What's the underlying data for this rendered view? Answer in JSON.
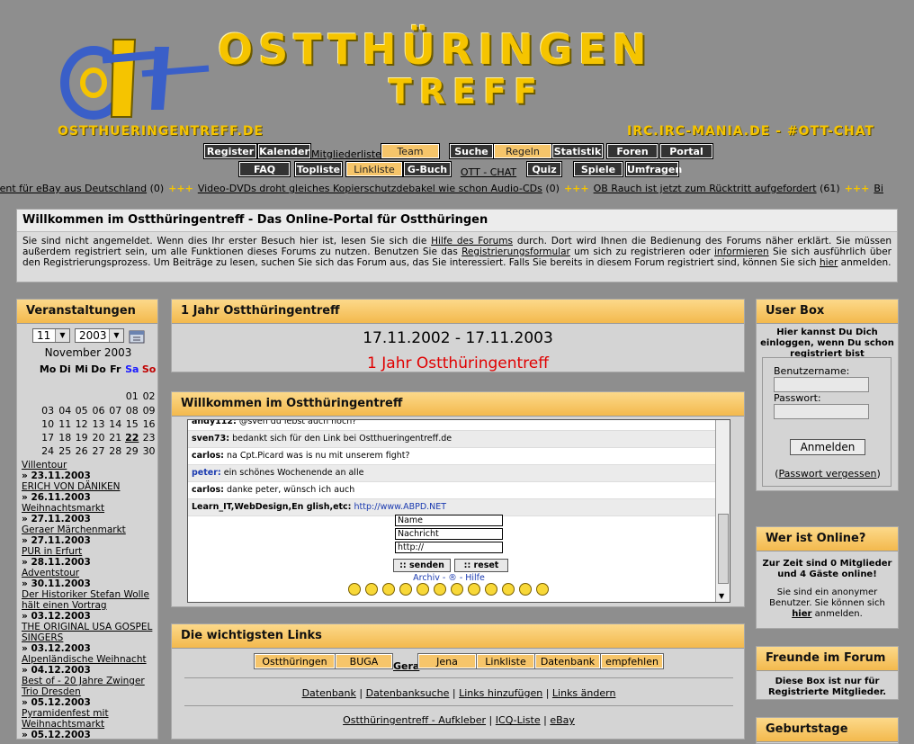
{
  "banner": {
    "title_line1": "OSTTHÜRINGEN",
    "title_line2": "TREFF",
    "url_left": "OSTTHUERINGENTREFF.DE",
    "url_right": "IRC.IRC-MANIA.DE - #OTT-CHAT",
    "logo_icon": "ott-logo-icon"
  },
  "nav_row1": [
    {
      "label": "Register",
      "style": "dark"
    },
    {
      "label": "Kalender",
      "style": "dark"
    },
    {
      "label": "Mitgliederliste",
      "style": "plain"
    },
    {
      "label": "Team",
      "style": "gold"
    },
    {
      "label": "Suche",
      "style": "dark"
    },
    {
      "label": "Regeln",
      "style": "gold"
    },
    {
      "label": "Statistik",
      "style": "dark"
    },
    {
      "label": "Foren",
      "style": "dark"
    },
    {
      "label": "Portal",
      "style": "dark"
    }
  ],
  "nav_row2": [
    {
      "label": "FAQ",
      "style": "dark"
    },
    {
      "label": "Topliste",
      "style": "dark"
    },
    {
      "label": "Linkliste",
      "style": "gold"
    },
    {
      "label": "G-Buch",
      "style": "dark"
    },
    {
      "label": "OTT - CHAT",
      "style": "plain"
    },
    {
      "label": "Quiz",
      "style": "dark"
    },
    {
      "label": "Spiele",
      "style": "dark"
    },
    {
      "label": "Umfragen",
      "style": "dark"
    }
  ],
  "ticker": [
    {
      "text": "current für eBay aus Deutschland",
      "count": "(0)"
    },
    {
      "text": "Video-DVDs droht gleiches Kopierschutzdebakel wie schon Audio-CDs",
      "count": "(0)"
    },
    {
      "text": "OB Rauch ist jetzt zum Rücktritt aufgefordert",
      "count": "(61)"
    },
    {
      "text": "Bi",
      "count": ""
    }
  ],
  "ticker_sep": "+++",
  "welcome": {
    "title": "Willkommen im Ostthüringentreff - Das Online-Portal für Ostthüringen",
    "t1": "Sie sind nicht angemeldet. Wenn dies Ihr erster Besuch hier ist, lesen Sie sich die ",
    "l1": "Hilfe des Forums",
    "t2": " durch. Dort wird Ihnen die Bedienung des Forums näher erklärt. Sie müssen außerdem registriert sein, um alle Funktionen dieses Forums zu nutzen. Benutzen Sie das ",
    "l2": "Registrierungsformular",
    "t3": " um sich zu registrieren oder ",
    "l3": "informieren",
    "t4": " Sie sich ausführlich über den Registrierungsprozess. Um Beiträge zu lesen, suchen Sie sich das Forum aus, das Sie interessiert. Falls Sie bereits in diesem Forum registriert sind, können Sie sich ",
    "l4": "hier",
    "t5": " anmelden."
  },
  "events_box": {
    "title": "Veranstaltungen",
    "month_select": "11",
    "year_select": "2003",
    "month_label": "November 2003",
    "weekdays": [
      "Mo",
      "Di",
      "Mi",
      "Do",
      "Fr",
      "Sa",
      "So"
    ],
    "weeks": [
      [
        "",
        "",
        "",
        "",
        "",
        "01",
        "02"
      ],
      [
        "03",
        "04",
        "05",
        "06",
        "07",
        "08",
        "09"
      ],
      [
        "10",
        "11",
        "12",
        "13",
        "14",
        "15",
        "16"
      ],
      [
        "17",
        "18",
        "19",
        "20",
        "21",
        "22",
        "23"
      ],
      [
        "24",
        "25",
        "26",
        "27",
        "28",
        "29",
        "30"
      ]
    ],
    "today": "22",
    "events": [
      {
        "name": "Villentour",
        "date": "23.11.2003"
      },
      {
        "name": "ERICH VON DÄNIKEN",
        "date": "26.11.2003"
      },
      {
        "name": "Weihnachtsmarkt",
        "date": "27.11.2003"
      },
      {
        "name": "Geraer Märchenmarkt",
        "date": "27.11.2003"
      },
      {
        "name": "PUR in Erfurt",
        "date": "28.11.2003"
      },
      {
        "name": "Adventstour",
        "date": "30.11.2003"
      },
      {
        "name": "Der Historiker Stefan Wolle hält einen Vortrag",
        "date": "03.12.2003"
      },
      {
        "name": "THE ORIGINAL USA GOSPEL SINGERS",
        "date": "03.12.2003"
      },
      {
        "name": "Alpenländische Weihnacht",
        "date": "04.12.2003"
      },
      {
        "name": "Best of - 20 Jahre Zwinger Trio Dresden",
        "date": "05.12.2003"
      },
      {
        "name": "Pyramidenfest mit Weihnachtsmarkt",
        "date": "05.12.2003"
      }
    ]
  },
  "year_box": {
    "title": "1 Jahr Ostthüringentreff",
    "dates": "17.11.2002 - 17.11.2003",
    "highlight": "1 Jahr Ostthüringentreff"
  },
  "welcome_box": {
    "title": "Willkommen im Ostthüringentreff",
    "chat": [
      {
        "user": "andy112:",
        "msg": " @sven du lebst auch noch?",
        "user_color": "#000000",
        "url": ""
      },
      {
        "user": "sven73:",
        "msg": " bedankt sich für den Link bei Ostthueringentreff.de",
        "user_color": "#000000",
        "url": ""
      },
      {
        "user": "carlos:",
        "msg": " na Cpt.Picard was is nu mit unserem fight?",
        "user_color": "#000000",
        "url": ""
      },
      {
        "user": "peter:",
        "msg": " ein schönes Wochenende an alle",
        "user_color": "#1a3ab0",
        "url": ""
      },
      {
        "user": "carlos:",
        "msg": " danke peter, wünsch ich auch",
        "user_color": "#000000",
        "url": ""
      },
      {
        "user": "Learn_IT,WebDesign,En glish,etc:",
        "msg": " ",
        "user_color": "#000000",
        "url": "http://www.ABPD.NET"
      }
    ],
    "name_value": "Name",
    "message_value": "Nachricht",
    "url_value": "http://",
    "send_label": ":: senden",
    "reset_label": ":: reset",
    "links_text": "Archiv - ® - Hilfe"
  },
  "links_box": {
    "title": "Die wichtigsten Links",
    "cats": [
      "Ostthüringen",
      "BUGA",
      "Gera",
      "Jena",
      "Linkliste",
      "Datenbank",
      "empfehlen"
    ],
    "row1": [
      "Datenbank",
      "Datenbanksuche",
      "Links hinzufügen",
      "Links ändern"
    ],
    "row2": [
      "Ostthüringentreff - Aufkleber",
      "ICQ-Liste",
      "eBay"
    ],
    "sep": "|"
  },
  "userbox": {
    "title": "User Box",
    "intro": "Hier kannst Du Dich einloggen, wenn Du schon registriert bist",
    "username_label": "Benutzername:",
    "password_label": "Passwort:",
    "login_label": "Anmelden",
    "forgot_open": "(",
    "forgot_label": "Passwort vergessen",
    "forgot_close": ")"
  },
  "online_box": {
    "title": "Wer ist Online?",
    "stats": "Zur Zeit sind 0 Mitglieder und 4 Gäste online!",
    "anon_text": "Sie sind ein anonymer Benutzer. Sie können sich ",
    "anon_link": "hier",
    "anon_end": " anmelden."
  },
  "friends_box": {
    "title": "Freunde im Forum",
    "text": "Diese Box ist nur für Registrierte Mitglieder."
  },
  "birthday_box": {
    "title": "Geburtstage"
  },
  "colors": {
    "page_bg": "#8e8e8e",
    "header_gold": "#f5c400",
    "box_header": "#f6c56a",
    "alert_red": "#e00000",
    "weekend_sat": "#1a1aff",
    "weekend_sun": "#c00000"
  }
}
